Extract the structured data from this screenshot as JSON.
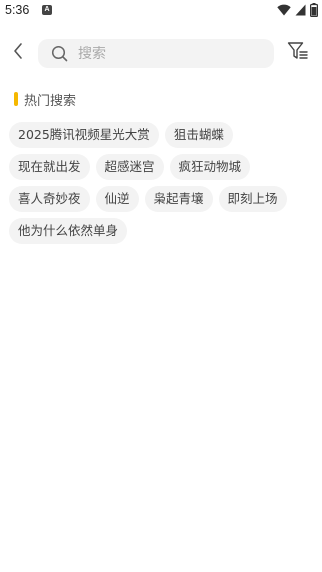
{
  "status_bar": {
    "time": "5:36",
    "notification_glyph": "A",
    "icons": [
      "wifi-icon",
      "cellular-signal-icon",
      "battery-icon"
    ]
  },
  "header": {
    "back_icon": "chevron-left-icon",
    "search_placeholder": "搜索",
    "search_value": "",
    "filter_icon": "filter-icon"
  },
  "hot_search": {
    "title": "热门搜索",
    "accent_color": "#f5b800",
    "tags": [
      "2025腾讯视频星光大赏",
      "狙击蝴蝶",
      "现在就出发",
      "超感迷宫",
      "疯狂动物城",
      "喜人奇妙夜",
      "仙逆",
      "枭起青壤",
      "即刻上场",
      "他为什么依然单身"
    ]
  }
}
